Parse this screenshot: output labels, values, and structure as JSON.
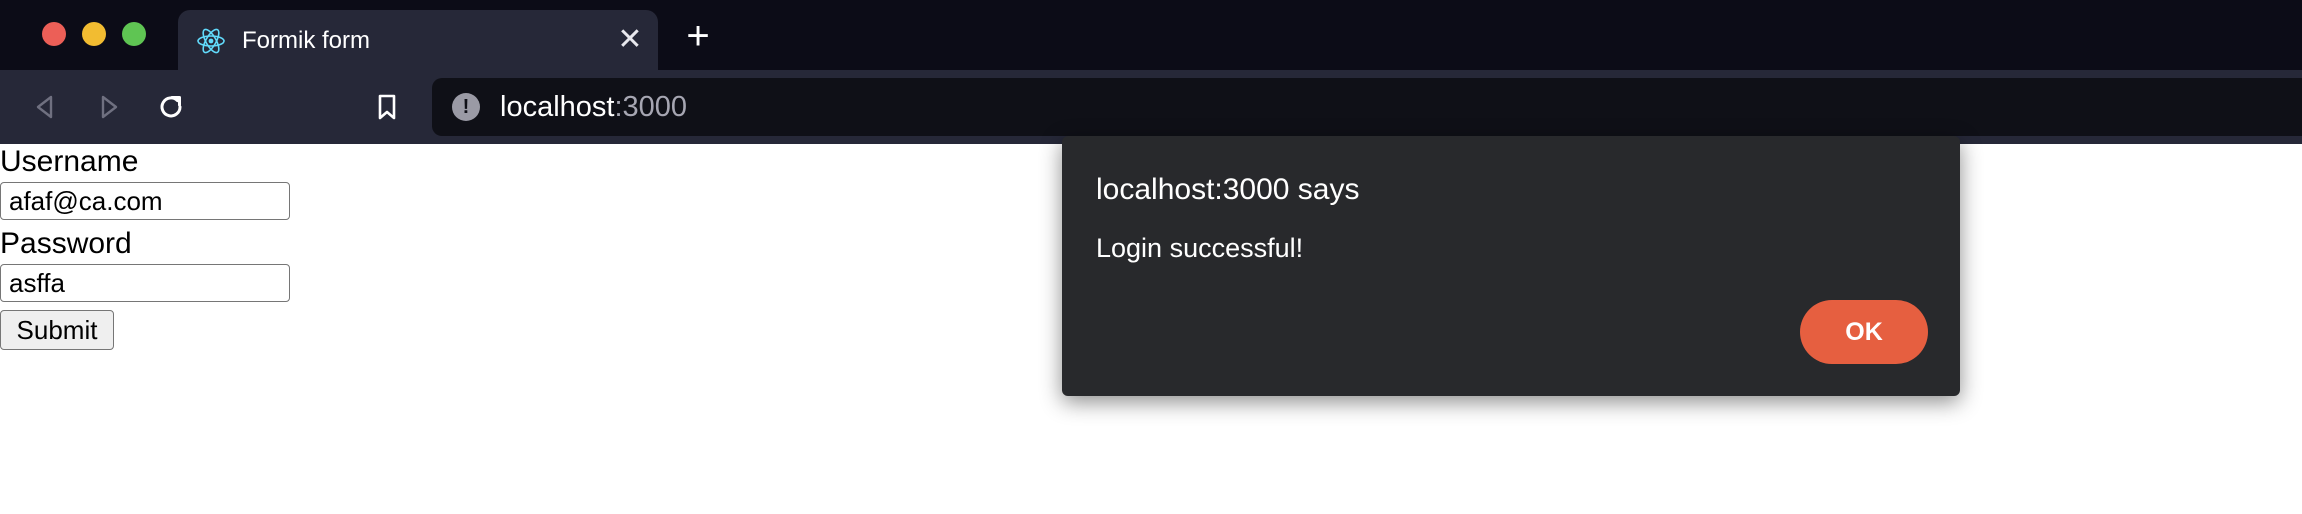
{
  "browser": {
    "tab": {
      "title": "Formik form",
      "favicon": "react-icon",
      "close_icon": "close-icon"
    },
    "new_tab_icon": "plus-icon",
    "toolbar": {
      "back_icon": "back-arrow-icon",
      "forward_icon": "forward-arrow-icon",
      "reload_icon": "reload-icon",
      "bookmark_icon": "bookmark-icon"
    },
    "address": {
      "host": "localhost",
      "port": ":3000",
      "security_icon": "info-icon"
    }
  },
  "form": {
    "username_label": "Username",
    "username_value": "afaf@ca.com",
    "password_label": "Password",
    "password_value": "asffa",
    "submit_label": "Submit"
  },
  "dialog": {
    "title": "localhost:3000 says",
    "message": "Login successful!",
    "ok_label": "OK"
  },
  "colors": {
    "titlebar": "#0c0c17",
    "toolbar": "#262838",
    "dialog_bg": "#28292c",
    "ok_accent": "#e65f40"
  }
}
